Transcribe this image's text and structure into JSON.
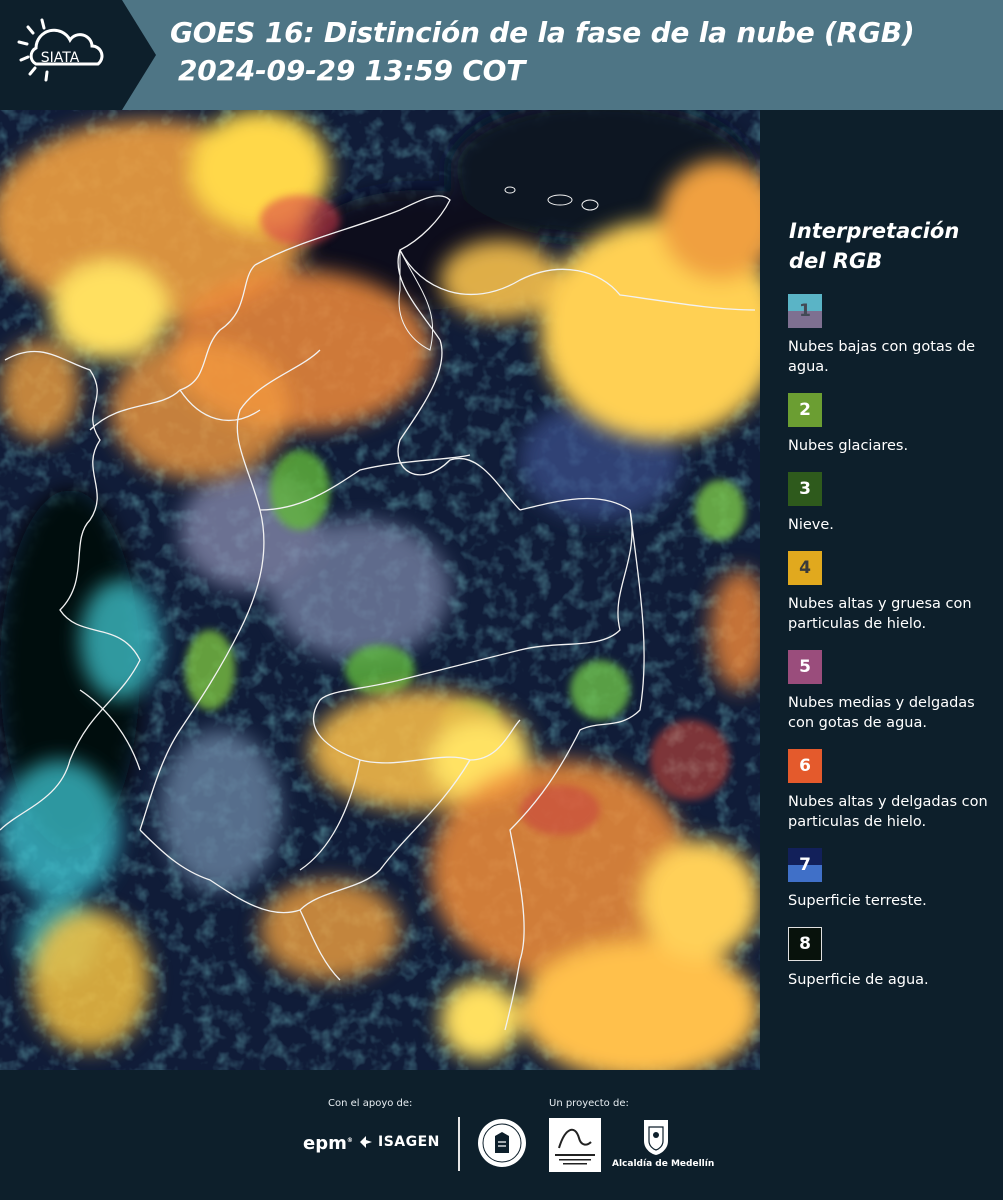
{
  "header": {
    "logo_text": "SIATA",
    "title_line1": "GOES 16: Distinción de la fase de la nube (RGB)",
    "title_line2": "2024-09-29 13:59 COT"
  },
  "legend": {
    "title_line1": "Interpretación",
    "title_line2": "del RGB",
    "items": [
      {
        "number": "1",
        "text": "Nubes bajas con gotas de agua.",
        "colors": [
          "#5ab4c6",
          "#7e7091"
        ]
      },
      {
        "number": "2",
        "text": "Nubes glaciares.",
        "colors": [
          "#6b9e32"
        ]
      },
      {
        "number": "3",
        "text": "Nieve.",
        "colors": [
          "#2e5a1c"
        ]
      },
      {
        "number": "4",
        "text": "Nubes altas y gruesa con particulas de hielo.",
        "colors": [
          "#e1a91e"
        ]
      },
      {
        "number": "5",
        "text": "Nubes medias y delgadas con gotas de agua.",
        "colors": [
          "#9a4d7c"
        ]
      },
      {
        "number": "6",
        "text": "Nubes altas y delgadas con particulas de hielo.",
        "colors": [
          "#e45a2c"
        ]
      },
      {
        "number": "7",
        "text": "Superficie terreste.",
        "colors": [
          "#12205a",
          "#4070c8"
        ]
      },
      {
        "number": "8",
        "text": "Superficie de agua.",
        "colors": [
          "#08120c"
        ]
      }
    ]
  },
  "footer": {
    "support_label": "Con el apoyo de:",
    "project_label": "Un proyecto de:",
    "epm_logo": "epm",
    "isagen_logo": "ISAGEN",
    "area_logo": "Área Metropolitana Valle de Aburrá",
    "alcaldia_label": "Alcaldía de Medellín"
  }
}
